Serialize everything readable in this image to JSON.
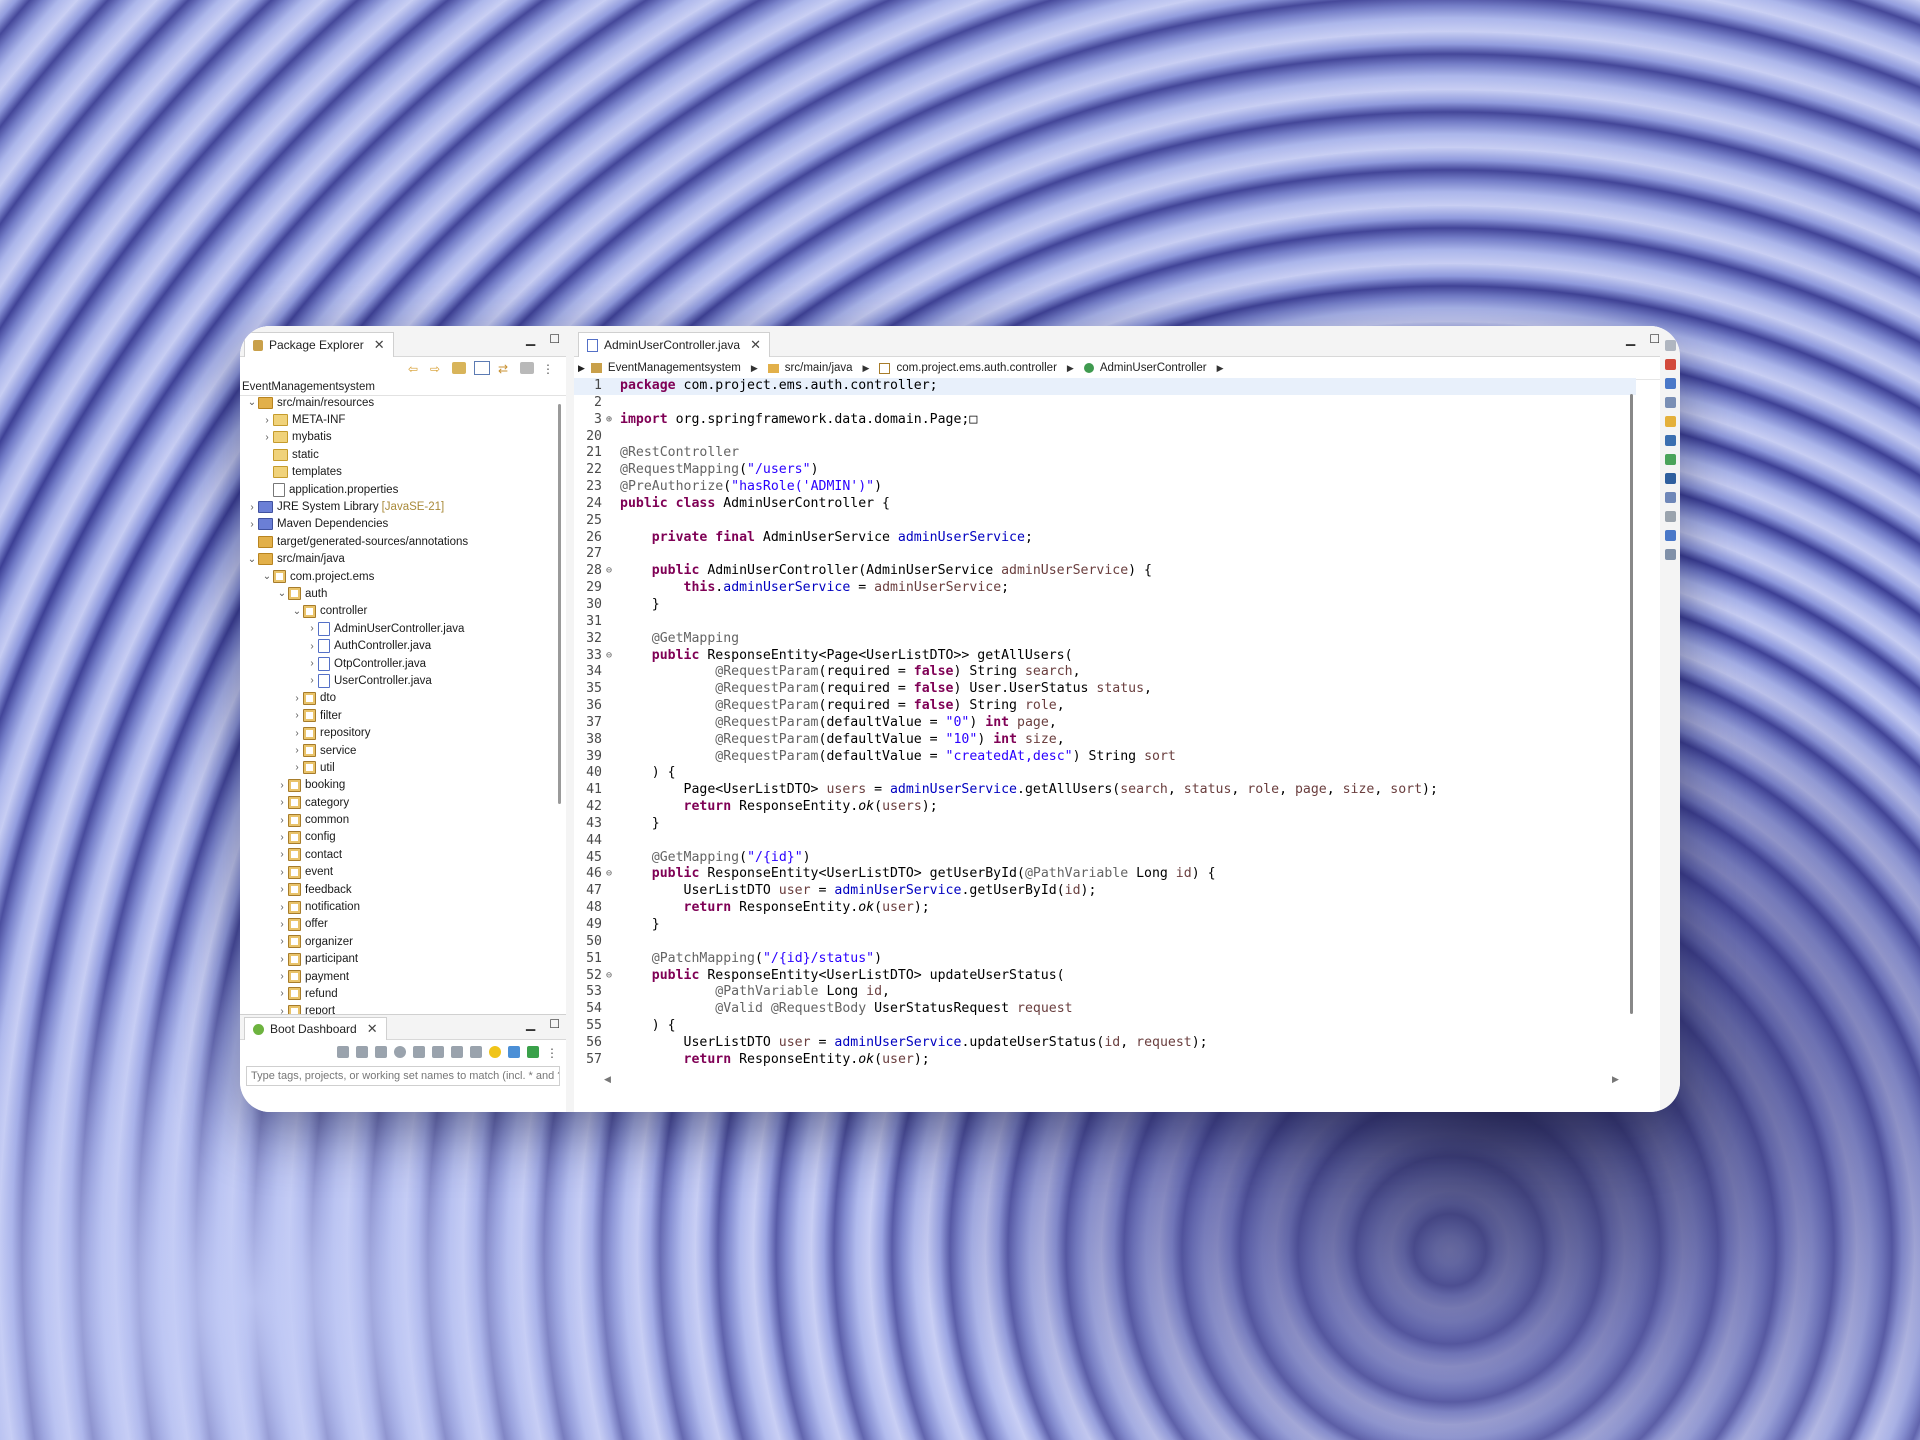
{
  "package_explorer": {
    "tab_label": "Package Explorer",
    "project": "EventManagementsystem",
    "tree": [
      {
        "indent": 0,
        "chev": "v",
        "icon": "src",
        "label": "src/main/resources"
      },
      {
        "indent": 1,
        "chev": ">",
        "icon": "dir",
        "label": "META-INF"
      },
      {
        "indent": 1,
        "chev": ">",
        "icon": "dir",
        "label": "mybatis"
      },
      {
        "indent": 1,
        "chev": "",
        "icon": "dir",
        "label": "static"
      },
      {
        "indent": 1,
        "chev": "",
        "icon": "dir",
        "label": "templates"
      },
      {
        "indent": 1,
        "chev": "",
        "icon": "file",
        "label": "application.properties"
      },
      {
        "indent": 0,
        "chev": ">",
        "icon": "jar",
        "label": "JRE System Library",
        "extra": "[JavaSE-21]"
      },
      {
        "indent": 0,
        "chev": ">",
        "icon": "jar",
        "label": "Maven Dependencies"
      },
      {
        "indent": 0,
        "chev": "",
        "icon": "src",
        "label": "target/generated-sources/annotations"
      },
      {
        "indent": 0,
        "chev": "v",
        "icon": "src",
        "label": "src/main/java"
      },
      {
        "indent": 1,
        "chev": "v",
        "icon": "pkg",
        "label": "com.project.ems"
      },
      {
        "indent": 2,
        "chev": "v",
        "icon": "pkg",
        "label": "auth"
      },
      {
        "indent": 3,
        "chev": "v",
        "icon": "pkg",
        "label": "controller"
      },
      {
        "indent": 4,
        "chev": ">",
        "icon": "java",
        "label": "AdminUserController.java"
      },
      {
        "indent": 4,
        "chev": ">",
        "icon": "java",
        "label": "AuthController.java"
      },
      {
        "indent": 4,
        "chev": ">",
        "icon": "java",
        "label": "OtpController.java"
      },
      {
        "indent": 4,
        "chev": ">",
        "icon": "java",
        "label": "UserController.java"
      },
      {
        "indent": 3,
        "chev": ">",
        "icon": "pkg",
        "label": "dto"
      },
      {
        "indent": 3,
        "chev": ">",
        "icon": "pkg",
        "label": "filter"
      },
      {
        "indent": 3,
        "chev": ">",
        "icon": "pkg",
        "label": "repository"
      },
      {
        "indent": 3,
        "chev": ">",
        "icon": "pkg",
        "label": "service"
      },
      {
        "indent": 3,
        "chev": ">",
        "icon": "pkg",
        "label": "util"
      },
      {
        "indent": 2,
        "chev": ">",
        "icon": "pkg",
        "label": "booking"
      },
      {
        "indent": 2,
        "chev": ">",
        "icon": "pkg",
        "label": "category"
      },
      {
        "indent": 2,
        "chev": ">",
        "icon": "pkg",
        "label": "common"
      },
      {
        "indent": 2,
        "chev": ">",
        "icon": "pkg",
        "label": "config"
      },
      {
        "indent": 2,
        "chev": ">",
        "icon": "pkg",
        "label": "contact"
      },
      {
        "indent": 2,
        "chev": ">",
        "icon": "pkg",
        "label": "event"
      },
      {
        "indent": 2,
        "chev": ">",
        "icon": "pkg",
        "label": "feedback"
      },
      {
        "indent": 2,
        "chev": ">",
        "icon": "pkg",
        "label": "notification"
      },
      {
        "indent": 2,
        "chev": ">",
        "icon": "pkg",
        "label": "offer"
      },
      {
        "indent": 2,
        "chev": ">",
        "icon": "pkg",
        "label": "organizer"
      },
      {
        "indent": 2,
        "chev": ">",
        "icon": "pkg",
        "label": "participant"
      },
      {
        "indent": 2,
        "chev": ">",
        "icon": "pkg",
        "label": "payment"
      },
      {
        "indent": 2,
        "chev": ">",
        "icon": "pkg",
        "label": "refund"
      },
      {
        "indent": 2,
        "chev": ">",
        "icon": "pkg",
        "label": "report"
      }
    ]
  },
  "boot_dashboard": {
    "tab_label": "Boot Dashboard",
    "search_placeholder": "Type tags, projects, or working set names to match (incl. * and ?)"
  },
  "editor": {
    "tab_label": "AdminUserController.java",
    "breadcrumb": [
      "EventManagementsystem",
      "src/main/java",
      "com.project.ems.auth.controller",
      "AdminUserController"
    ],
    "lines": [
      {
        "n": "1",
        "cur": true,
        "t": [
          [
            "kw",
            "package"
          ],
          [
            "src",
            " com.project.ems.auth.controller;"
          ]
        ]
      },
      {
        "n": "2",
        "t": []
      },
      {
        "n": "3",
        "fold": "+",
        "t": [
          [
            "kw",
            "import"
          ],
          [
            "src",
            " org.springframework.data.domain.Page;"
          ],
          [
            "src",
            "□"
          ]
        ]
      },
      {
        "n": "20",
        "t": []
      },
      {
        "n": "21",
        "t": [
          [
            "ann",
            "@RestController"
          ]
        ]
      },
      {
        "n": "22",
        "t": [
          [
            "ann",
            "@RequestMapping"
          ],
          [
            "src",
            "("
          ],
          [
            "str",
            "\"/users\""
          ],
          [
            "src",
            ")"
          ]
        ]
      },
      {
        "n": "23",
        "t": [
          [
            "ann",
            "@PreAuthorize"
          ],
          [
            "src",
            "("
          ],
          [
            "str",
            "\"hasRole('ADMIN')\""
          ],
          [
            "src",
            ")"
          ]
        ]
      },
      {
        "n": "24",
        "t": [
          [
            "kw",
            "public class"
          ],
          [
            "src",
            " AdminUserController {"
          ]
        ]
      },
      {
        "n": "25",
        "t": []
      },
      {
        "n": "26",
        "t": [
          [
            "src",
            "    "
          ],
          [
            "kw",
            "private final"
          ],
          [
            "src",
            " AdminUserService "
          ],
          [
            "fld",
            "adminUserService"
          ],
          [
            "src",
            ";"
          ]
        ]
      },
      {
        "n": "27",
        "t": []
      },
      {
        "n": "28",
        "fold": "-",
        "t": [
          [
            "src",
            "    "
          ],
          [
            "kw",
            "public"
          ],
          [
            "src",
            " AdminUserController(AdminUserService "
          ],
          [
            "par",
            "adminUserService"
          ],
          [
            "src",
            ") {"
          ]
        ]
      },
      {
        "n": "29",
        "t": [
          [
            "src",
            "        "
          ],
          [
            "kw",
            "this"
          ],
          [
            "src",
            "."
          ],
          [
            "fld",
            "adminUserService"
          ],
          [
            "src",
            " = "
          ],
          [
            "par",
            "adminUserService"
          ],
          [
            "src",
            ";"
          ]
        ]
      },
      {
        "n": "30",
        "t": [
          [
            "src",
            "    }"
          ]
        ]
      },
      {
        "n": "31",
        "t": []
      },
      {
        "n": "32",
        "t": [
          [
            "src",
            "    "
          ],
          [
            "ann",
            "@GetMapping"
          ]
        ]
      },
      {
        "n": "33",
        "fold": "-",
        "t": [
          [
            "src",
            "    "
          ],
          [
            "kw",
            "public"
          ],
          [
            "src",
            " ResponseEntity<Page<UserListDTO>> getAllUsers("
          ]
        ]
      },
      {
        "n": "34",
        "t": [
          [
            "src",
            "            "
          ],
          [
            "ann",
            "@RequestParam"
          ],
          [
            "src",
            "(required = "
          ],
          [
            "kw",
            "false"
          ],
          [
            "src",
            ") String "
          ],
          [
            "par",
            "search"
          ],
          [
            "src",
            ","
          ]
        ]
      },
      {
        "n": "35",
        "t": [
          [
            "src",
            "            "
          ],
          [
            "ann",
            "@RequestParam"
          ],
          [
            "src",
            "(required = "
          ],
          [
            "kw",
            "false"
          ],
          [
            "src",
            ") User.UserStatus "
          ],
          [
            "par",
            "status"
          ],
          [
            "src",
            ","
          ]
        ]
      },
      {
        "n": "36",
        "t": [
          [
            "src",
            "            "
          ],
          [
            "ann",
            "@RequestParam"
          ],
          [
            "src",
            "(required = "
          ],
          [
            "kw",
            "false"
          ],
          [
            "src",
            ") String "
          ],
          [
            "par",
            "role"
          ],
          [
            "src",
            ","
          ]
        ]
      },
      {
        "n": "37",
        "t": [
          [
            "src",
            "            "
          ],
          [
            "ann",
            "@RequestParam"
          ],
          [
            "src",
            "(defaultValue = "
          ],
          [
            "str",
            "\"0\""
          ],
          [
            "src",
            ") "
          ],
          [
            "kw",
            "int"
          ],
          [
            "src",
            " "
          ],
          [
            "par",
            "page"
          ],
          [
            "src",
            ","
          ]
        ]
      },
      {
        "n": "38",
        "t": [
          [
            "src",
            "            "
          ],
          [
            "ann",
            "@RequestParam"
          ],
          [
            "src",
            "(defaultValue = "
          ],
          [
            "str",
            "\"10\""
          ],
          [
            "src",
            ") "
          ],
          [
            "kw",
            "int"
          ],
          [
            "src",
            " "
          ],
          [
            "par",
            "size"
          ],
          [
            "src",
            ","
          ]
        ]
      },
      {
        "n": "39",
        "t": [
          [
            "src",
            "            "
          ],
          [
            "ann",
            "@RequestParam"
          ],
          [
            "src",
            "(defaultValue = "
          ],
          [
            "str",
            "\"createdAt,desc\""
          ],
          [
            "src",
            ") String "
          ],
          [
            "par",
            "sort"
          ]
        ]
      },
      {
        "n": "40",
        "t": [
          [
            "src",
            "    ) {"
          ]
        ]
      },
      {
        "n": "41",
        "t": [
          [
            "src",
            "        Page<UserListDTO> "
          ],
          [
            "par",
            "users"
          ],
          [
            "src",
            " = "
          ],
          [
            "fld",
            "adminUserService"
          ],
          [
            "src",
            ".getAllUsers("
          ],
          [
            "par",
            "search"
          ],
          [
            "src",
            ", "
          ],
          [
            "par",
            "status"
          ],
          [
            "src",
            ", "
          ],
          [
            "par",
            "role"
          ],
          [
            "src",
            ", "
          ],
          [
            "par",
            "page"
          ],
          [
            "src",
            ", "
          ],
          [
            "par",
            "size"
          ],
          [
            "src",
            ", "
          ],
          [
            "par",
            "sort"
          ],
          [
            "src",
            ");"
          ]
        ]
      },
      {
        "n": "42",
        "t": [
          [
            "src",
            "        "
          ],
          [
            "kw",
            "return"
          ],
          [
            "src",
            " ResponseEntity."
          ],
          [
            "sti",
            "ok"
          ],
          [
            "src",
            "("
          ],
          [
            "par",
            "users"
          ],
          [
            "src",
            ");"
          ]
        ]
      },
      {
        "n": "43",
        "t": [
          [
            "src",
            "    }"
          ]
        ]
      },
      {
        "n": "44",
        "t": []
      },
      {
        "n": "45",
        "t": [
          [
            "src",
            "    "
          ],
          [
            "ann",
            "@GetMapping"
          ],
          [
            "src",
            "("
          ],
          [
            "str",
            "\"/{id}\""
          ],
          [
            "src",
            ")"
          ]
        ]
      },
      {
        "n": "46",
        "fold": "-",
        "t": [
          [
            "src",
            "    "
          ],
          [
            "kw",
            "public"
          ],
          [
            "src",
            " ResponseEntity<UserListDTO> getUserById("
          ],
          [
            "ann",
            "@PathVariable"
          ],
          [
            "src",
            " Long "
          ],
          [
            "par",
            "id"
          ],
          [
            "src",
            ") {"
          ]
        ]
      },
      {
        "n": "47",
        "t": [
          [
            "src",
            "        UserListDTO "
          ],
          [
            "par",
            "user"
          ],
          [
            "src",
            " = "
          ],
          [
            "fld",
            "adminUserService"
          ],
          [
            "src",
            ".getUserById("
          ],
          [
            "par",
            "id"
          ],
          [
            "src",
            ");"
          ]
        ]
      },
      {
        "n": "48",
        "t": [
          [
            "src",
            "        "
          ],
          [
            "kw",
            "return"
          ],
          [
            "src",
            " ResponseEntity."
          ],
          [
            "sti",
            "ok"
          ],
          [
            "src",
            "("
          ],
          [
            "par",
            "user"
          ],
          [
            "src",
            ");"
          ]
        ]
      },
      {
        "n": "49",
        "t": [
          [
            "src",
            "    }"
          ]
        ]
      },
      {
        "n": "50",
        "t": []
      },
      {
        "n": "51",
        "t": [
          [
            "src",
            "    "
          ],
          [
            "ann",
            "@PatchMapping"
          ],
          [
            "src",
            "("
          ],
          [
            "str",
            "\"/{id}/status\""
          ],
          [
            "src",
            ")"
          ]
        ]
      },
      {
        "n": "52",
        "fold": "-",
        "t": [
          [
            "src",
            "    "
          ],
          [
            "kw",
            "public"
          ],
          [
            "src",
            " ResponseEntity<UserListDTO> updateUserStatus("
          ]
        ]
      },
      {
        "n": "53",
        "t": [
          [
            "src",
            "            "
          ],
          [
            "ann",
            "@PathVariable"
          ],
          [
            "src",
            " Long "
          ],
          [
            "par",
            "id"
          ],
          [
            "src",
            ","
          ]
        ]
      },
      {
        "n": "54",
        "t": [
          [
            "src",
            "            "
          ],
          [
            "ann",
            "@Valid @RequestBody"
          ],
          [
            "src",
            " UserStatusRequest "
          ],
          [
            "par",
            "request"
          ]
        ]
      },
      {
        "n": "55",
        "t": [
          [
            "src",
            "    ) {"
          ]
        ]
      },
      {
        "n": "56",
        "t": [
          [
            "src",
            "        UserListDTO "
          ],
          [
            "par",
            "user"
          ],
          [
            "src",
            " = "
          ],
          [
            "fld",
            "adminUserService"
          ],
          [
            "src",
            ".updateUserStatus("
          ],
          [
            "par",
            "id"
          ],
          [
            "src",
            ", "
          ],
          [
            "par",
            "request"
          ],
          [
            "src",
            ");"
          ]
        ]
      },
      {
        "n": "57",
        "t": [
          [
            "src",
            "        "
          ],
          [
            "kw",
            "return"
          ],
          [
            "src",
            " ResponseEntity."
          ],
          [
            "sti",
            "ok"
          ],
          [
            "src",
            "("
          ],
          [
            "par",
            "user"
          ],
          [
            "src",
            ");"
          ]
        ]
      }
    ]
  },
  "colors": {
    "keyword": "#7f0055",
    "string": "#2a00ff",
    "annotation": "#646464",
    "field": "#0000c0",
    "parameter": "#6a3e3e"
  }
}
